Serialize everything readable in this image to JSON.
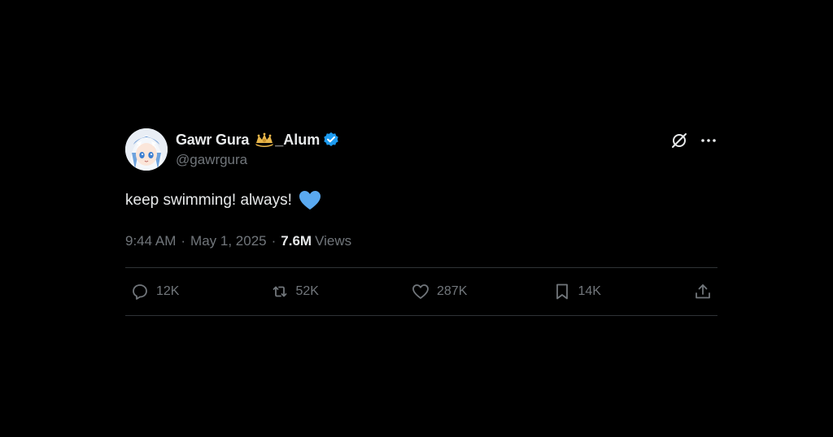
{
  "tweet": {
    "display_name": "Gawr Gura",
    "affiliation_suffix": "_Alum",
    "handle": "@gawrgura",
    "text": "keep swimming! always!",
    "time": "9:44 AM",
    "date": "May 1, 2025",
    "separator": "·",
    "views_count": "7.6M",
    "views_label": "Views"
  },
  "actions": {
    "replies": "12K",
    "reposts": "52K",
    "likes": "287K",
    "bookmarks": "14K"
  },
  "icons": {
    "affiliation": "crown-badge-icon",
    "verified": "verified-badge-icon",
    "heart_emoji": "blue-heart-emoji",
    "grok": "grok-icon",
    "more": "more-dots-icon",
    "reply": "reply-icon",
    "repost": "repost-icon",
    "like": "heart-icon",
    "bookmark": "bookmark-icon",
    "share": "share-icon"
  },
  "colors": {
    "background": "#000000",
    "primary_text": "#e7e9ea",
    "secondary_text": "#71767b",
    "verified_blue": "#1d9bf0",
    "heart_emoji_blue": "#5aa9f0",
    "crown_gold": "#e8b64a",
    "divider": "#2f3336"
  }
}
